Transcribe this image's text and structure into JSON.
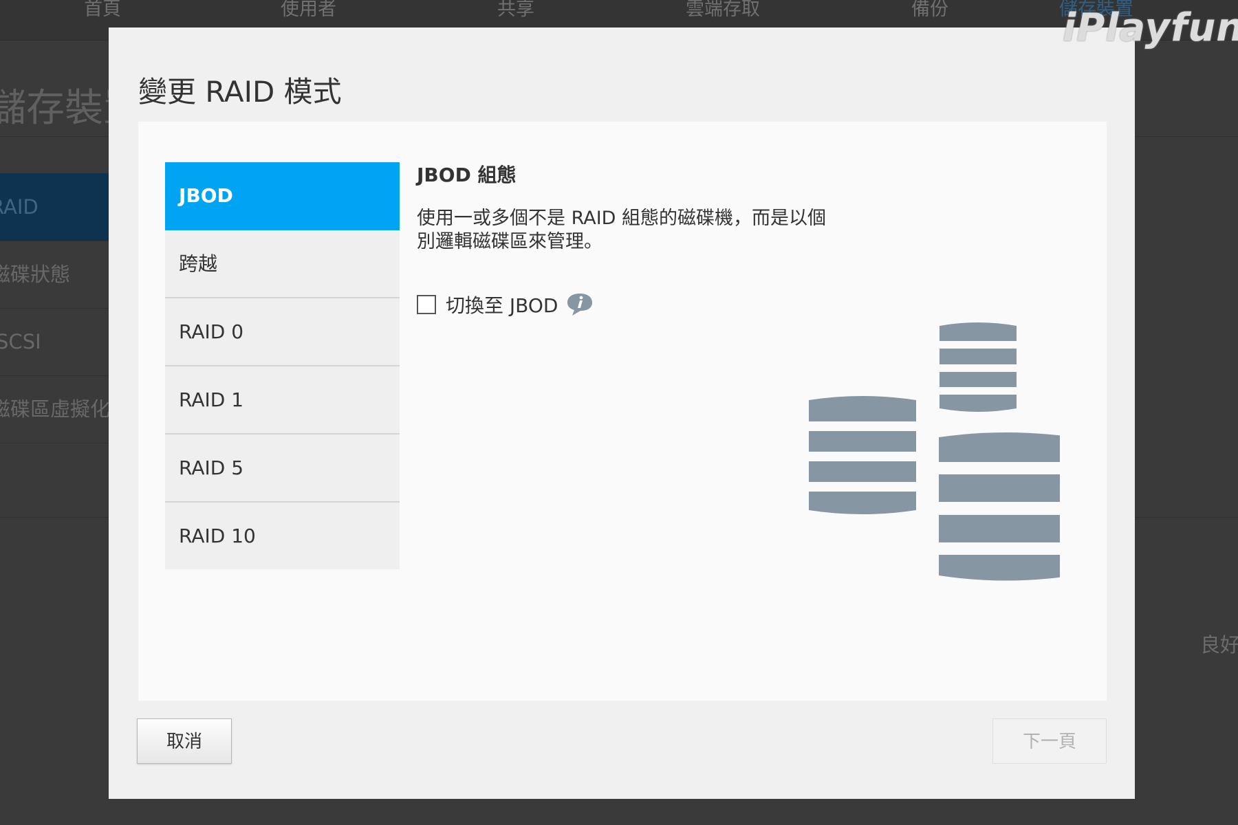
{
  "watermark": "iPlayfun",
  "background": {
    "nav": [
      "首頁",
      "使用者",
      "共享",
      "雲端存取",
      "備份",
      "儲存裝置"
    ],
    "page_title": "儲存裝置",
    "sidebar": [
      "RAID",
      "磁碟狀態",
      "iSCSI",
      "磁碟區虛擬化"
    ],
    "status_text": "良好"
  },
  "dialog": {
    "title": "變更 RAID 模式",
    "modes": [
      "JBOD",
      "跨越",
      "RAID 0",
      "RAID 1",
      "RAID 5",
      "RAID 10"
    ],
    "selected_mode": "JBOD",
    "detail": {
      "heading": "JBOD 組態",
      "description": "使用一或多個不是 RAID 組態的磁碟機，而是以個別邏輯磁碟區來管理。",
      "switch_label": "切換至 JBOD",
      "switch_checked": false,
      "info_icon": "info-bubble-icon"
    },
    "buttons": {
      "cancel": "取消",
      "next": "下一頁",
      "next_enabled": false
    }
  },
  "colors": {
    "selected_mode": "#00a4f2",
    "disk_icon": "#8696a3"
  }
}
